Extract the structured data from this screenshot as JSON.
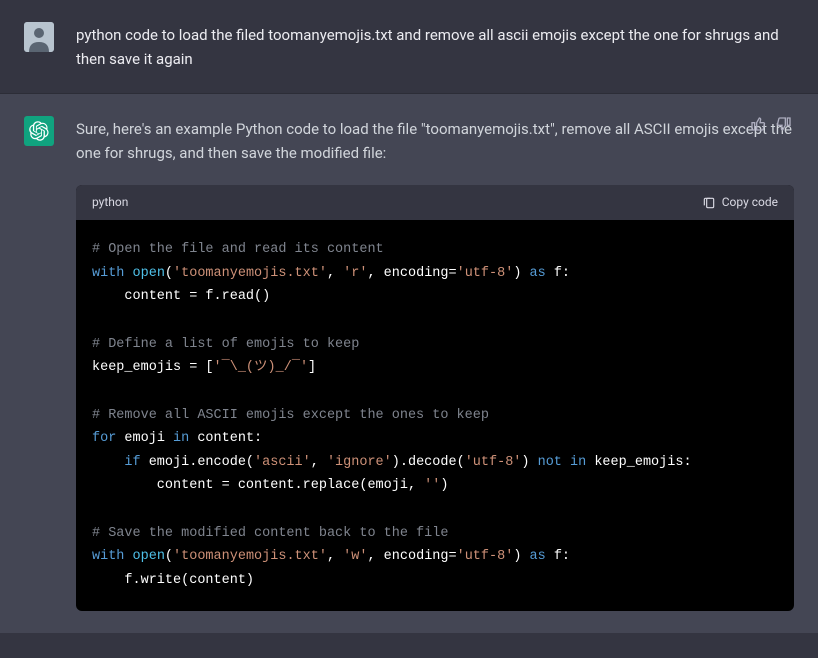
{
  "user": {
    "text": "python code to load the filed toomanyemojis.txt and remove all ascii emojis except the one for  shrugs and then save it again"
  },
  "assistant": {
    "intro": "Sure, here's an example Python code to load the file \"toomanyemojis.txt\", remove all ASCII emojis except the one for shrugs, and then save the modified file:",
    "code_lang": "python",
    "copy_label": "Copy code",
    "code": {
      "l1": "# Open the file and read its content",
      "l2a": "with",
      "l2b": "open",
      "l2c": "'toomanyemojis.txt'",
      "l2d": "'r'",
      "l2e": "'utf-8'",
      "l2f": "as",
      "l3": "    content = f.read()",
      "l4": "# Define a list of emojis to keep",
      "l5a": "keep_emojis = [",
      "l5b": "'¯\\_(ツ)_/¯'",
      "l5c": "]",
      "l6": "# Remove all ASCII emojis except the ones to keep",
      "l7a": "for",
      "l7b": "in",
      "l8a": "if",
      "l8b": "'ascii'",
      "l8c": "'ignore'",
      "l8d": "'utf-8'",
      "l8e": "not",
      "l8f": "in",
      "l9a": "        content = content.replace(emoji, ",
      "l9b": "''",
      "l9c": ")",
      "l10": "# Save the modified content back to the file",
      "l11a": "with",
      "l11b": "open",
      "l11c": "'toomanyemojis.txt'",
      "l11d": "'w'",
      "l11e": "'utf-8'",
      "l11f": "as",
      "l12": "    f.write(content)"
    }
  }
}
